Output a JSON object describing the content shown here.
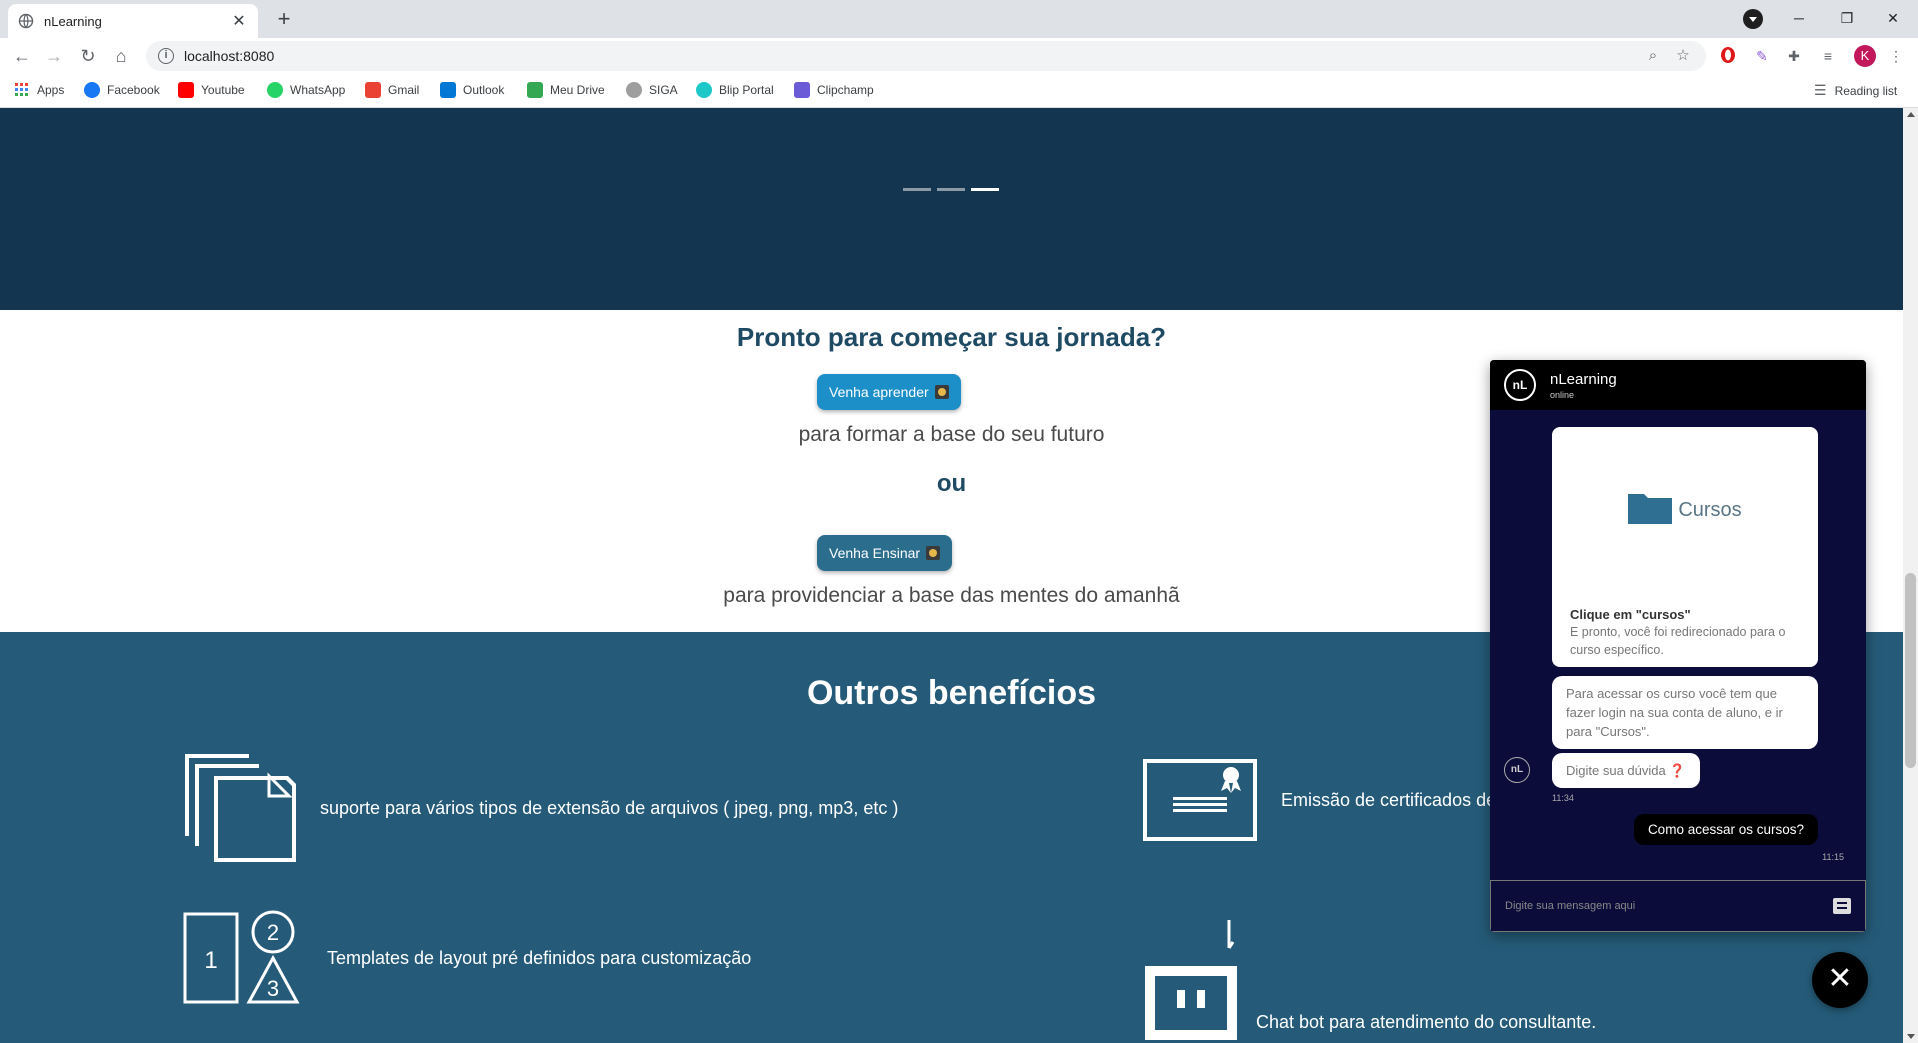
{
  "browser": {
    "tab_title": "nLearning",
    "tab_close": "✕",
    "new_tab": "+",
    "url": "localhost:8080",
    "info_glyph": "i",
    "window_controls": {
      "minimize": "─",
      "restore": "❐",
      "close": "✕"
    },
    "avatar_letter": "K",
    "bookmarks": [
      {
        "label": "Apps",
        "color": "#4285f4"
      },
      {
        "label": "Facebook",
        "color": "#1877f2"
      },
      {
        "label": "Youtube",
        "color": "#ff0000"
      },
      {
        "label": "WhatsApp",
        "color": "#25d366"
      },
      {
        "label": "Gmail",
        "color": "#ea4335"
      },
      {
        "label": "Outlook",
        "color": "#0078d4"
      },
      {
        "label": "Meu Drive",
        "color": "#34a853"
      },
      {
        "label": "SIGA",
        "color": "#9e9e9e"
      },
      {
        "label": "Blip Portal",
        "color": "#1ec8c8"
      },
      {
        "label": "Clipchamp",
        "color": "#6b5bd6"
      }
    ],
    "reading_list": "Reading list"
  },
  "hero": {
    "slide_count": 3,
    "active_slide": 3
  },
  "cta": {
    "title": "Pronto para começar sua jornada?",
    "learn_button": "Venha aprender",
    "learn_text": "para formar a base do seu futuro",
    "or_text": "ou",
    "teach_button": "Venha Ensinar",
    "teach_text": "para providenciar a base das mentes do amanhã"
  },
  "benefits": {
    "title": "Outros benefícios",
    "items": [
      {
        "text": "suporte para vários tipos de extensão de arquivos ( jpeg, png, mp3, etc )",
        "icon": "files-icon"
      },
      {
        "text": "Emissão de certificados de",
        "icon": "certificate-icon"
      },
      {
        "text": "Templates de layout pré definidos para customização",
        "icon": "templates-icon",
        "shape_numbers": [
          "1",
          "2",
          "3"
        ]
      },
      {
        "text": "Chat bot para atendimento do consultante.",
        "icon": "robot-icon"
      }
    ]
  },
  "chat": {
    "bot_name": "nLearning",
    "status": "online",
    "logo_text": "nL",
    "card": {
      "image_label": "Cursos",
      "title": "Clique em \"cursos\"",
      "description": "E pronto, você foi redirecionado para o curso específico."
    },
    "messages": {
      "bot_reply": "Para acessar os curso você tem que fazer login na sua conta de aluno, e ir para \"Cursos\".",
      "bot_prompt": "Digite sua dúvida",
      "bot_prompt_emoji": "❓",
      "bot_time": "11:34",
      "user_message": "Como acessar os cursos?",
      "user_time": "11:15"
    },
    "input_placeholder": "Digite sua mensagem aqui",
    "close_glyph": "✕"
  },
  "colors": {
    "hero_bg": "#14354f",
    "benefits_bg": "#255b78",
    "learn_button": "#1d8fc8",
    "teach_button": "#2b6d8c",
    "chat_bg": "#0b0c3a"
  }
}
